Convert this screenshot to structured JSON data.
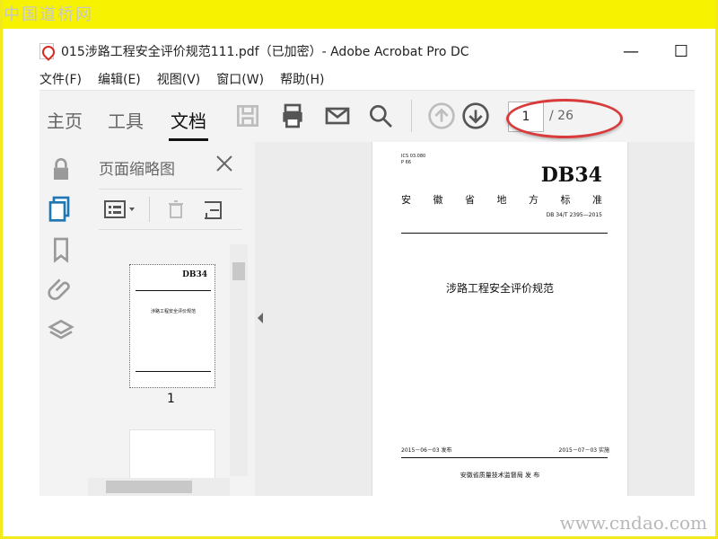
{
  "watermarks": {
    "top": "中国道桥网",
    "bottom": "www.cndao.com"
  },
  "window": {
    "title": "015涉路工程安全评价规范111.pdf（已加密）- Adobe Acrobat Pro DC",
    "minimize": "—",
    "maximize": "☐"
  },
  "menu": [
    {
      "label": "文件(F)"
    },
    {
      "label": "编辑(E)"
    },
    {
      "label": "视图(V)"
    },
    {
      "label": "窗口(W)"
    },
    {
      "label": "帮助(H)"
    }
  ],
  "toolbar": {
    "tabs": [
      {
        "label": "主页"
      },
      {
        "label": "工具"
      },
      {
        "label": "文档"
      }
    ],
    "active_tab": "文档",
    "page_current": "1",
    "page_total": "/ 26",
    "icons": [
      "save-icon",
      "print-icon",
      "email-icon",
      "search-icon",
      "page-up-icon",
      "page-down-icon"
    ],
    "highlight_color": "#d83b3b"
  },
  "left_rail": {
    "icons": [
      "lock-icon",
      "pages-icon",
      "bookmark-icon",
      "attachment-icon",
      "layers-icon"
    ],
    "accent": "#1f77b4"
  },
  "thumbnails_panel": {
    "title": "页面缩略图",
    "items": [
      {
        "page": "1"
      }
    ]
  },
  "document_page": {
    "ics": "ICS 03.080",
    "p": "P 66",
    "db": "DB34",
    "org": [
      "安",
      "徽",
      "省",
      "地",
      "方",
      "标",
      "准"
    ],
    "std": "DB 34/T 2395—2015",
    "title": "涉路工程安全评价规范",
    "date_left": "2015－06－03 发布",
    "date_right": "2015－07－03 实施",
    "publisher": "安徽省质量技术监督局    发 布"
  }
}
